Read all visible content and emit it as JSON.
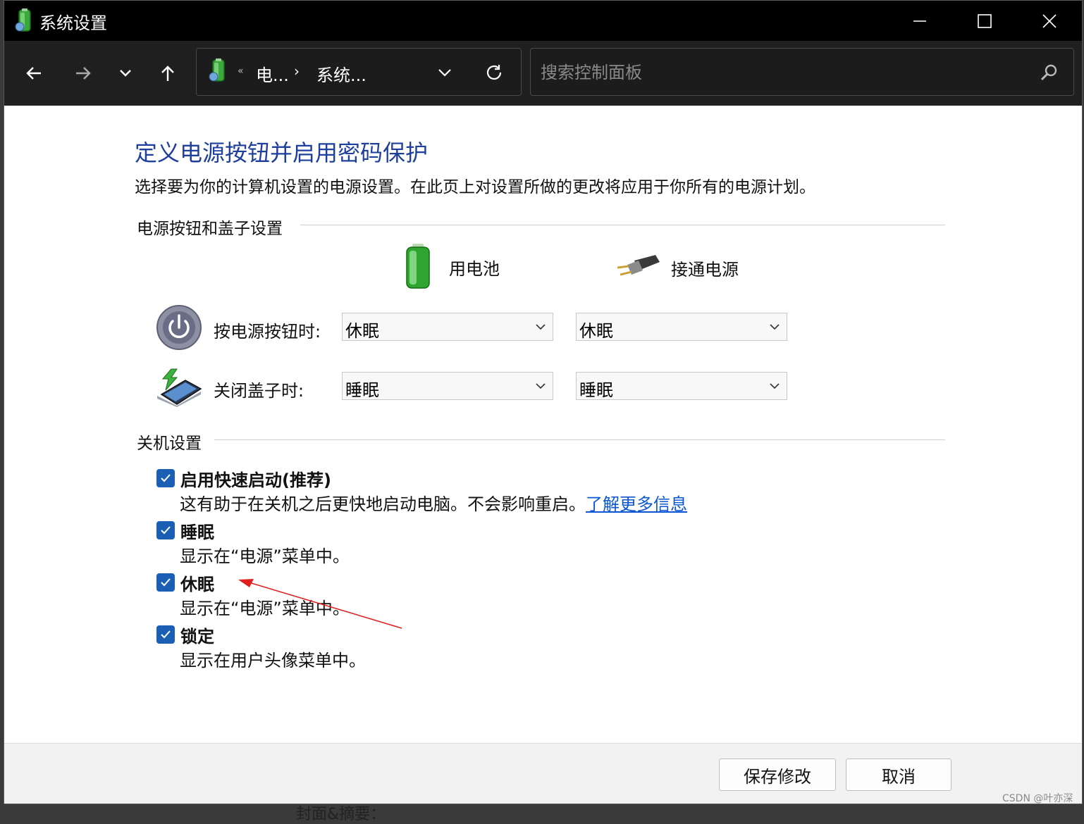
{
  "window": {
    "title": "系统设置"
  },
  "navbar": {
    "breadcrumb": [
      "电...",
      "系统..."
    ],
    "breadcrumb_overflow": "«",
    "breadcrumb_separator": "›",
    "search_placeholder": "搜索控制面板"
  },
  "page": {
    "title": "定义电源按钮并启用密码保护",
    "description": "选择要为你的计算机设置的电源设置。在此页上对设置所做的更改将应用于你所有的电源计划。"
  },
  "power_buttons": {
    "group_label": "电源按钮和盖子设置",
    "columns": {
      "battery": "用电池",
      "plugged_in": "接通电源"
    },
    "rows": [
      {
        "label": "按电源按钮时:",
        "battery": "休眠",
        "plugged_in": "休眠"
      },
      {
        "label": "关闭盖子时:",
        "battery": "睡眠",
        "plugged_in": "睡眠"
      }
    ]
  },
  "shutdown": {
    "group_label": "关机设置",
    "items": [
      {
        "title": "启用快速启动(推荐)",
        "desc": "这有助于在关机之后更快地启动电脑。不会影响重启。",
        "link": "了解更多信息",
        "checked": true
      },
      {
        "title": "睡眠",
        "desc": "显示在“电源”菜单中。",
        "checked": true
      },
      {
        "title": "休眠",
        "desc": "显示在“电源”菜单中。",
        "checked": true
      },
      {
        "title": "锁定",
        "desc": "显示在用户头像菜单中。",
        "checked": true
      }
    ]
  },
  "footer": {
    "save": "保存修改",
    "cancel": "取消"
  },
  "background_text": "封面&摘要：",
  "watermark": "CSDN @叶亦深",
  "colors": {
    "title_blue": "#1e3f9c",
    "checkbox_blue": "#1a5fb4",
    "link_blue": "#0a56d3",
    "annotation_arrow": "#e02020"
  }
}
